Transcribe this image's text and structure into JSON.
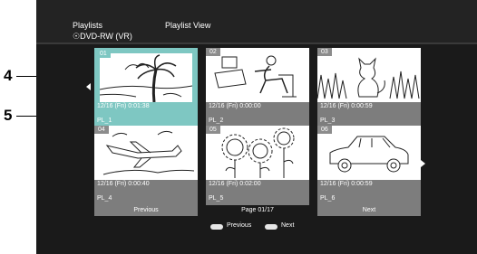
{
  "header": {
    "title": "Playlists",
    "view": "Playlist View",
    "disc": "DVD-RW (VR)"
  },
  "callouts": [
    "4",
    "5"
  ],
  "thumbnails": [
    {
      "num": "01",
      "date": "12/16 (Fri) 0:01:38",
      "name": "PL_1",
      "scene": "palm-beach"
    },
    {
      "num": "02",
      "date": "12/16 (Fri) 0:00:00",
      "name": "PL_2",
      "scene": "man-at-desk"
    },
    {
      "num": "03",
      "date": "12/16 (Fri) 0:00:59",
      "name": "PL_3",
      "scene": "cat-in-grass"
    },
    {
      "num": "04",
      "date": "12/16 (Fri) 0:00:40",
      "name": "PL_4",
      "scene": "airplane"
    },
    {
      "num": "05",
      "date": "12/16 (Fri) 0:02:00",
      "name": "PL_5",
      "scene": "sunflowers"
    },
    {
      "num": "06",
      "date": "12/16 (Fri) 0:00:59",
      "name": "PL_6",
      "scene": "car"
    }
  ],
  "nav": {
    "previous": "Previous",
    "page": "Page 01/17",
    "next": "Next"
  },
  "footer": {
    "previous": "Previous",
    "next": "Next"
  },
  "colors": {
    "selected": "#7ec7c2",
    "tile_info": "#7d7d7d",
    "background": "#1a1a1a"
  }
}
